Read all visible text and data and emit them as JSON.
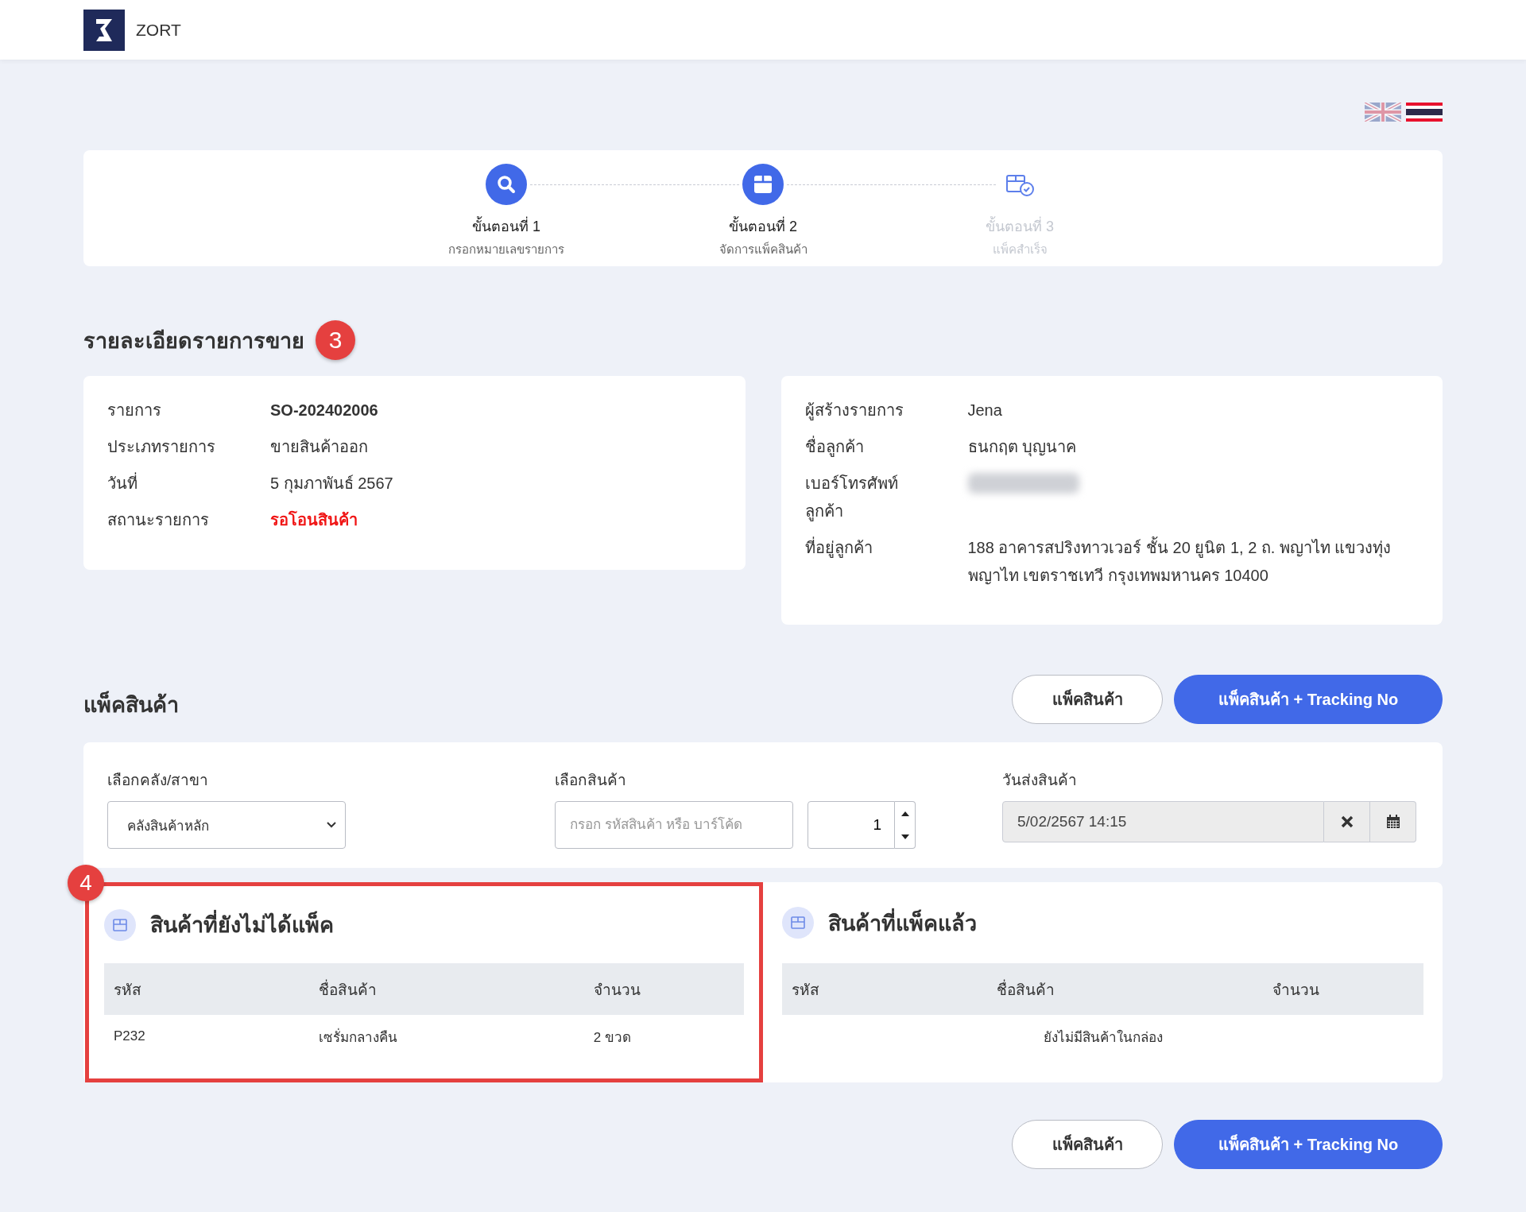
{
  "header": {
    "brand": "ZORT"
  },
  "languages": [
    {
      "kind": "en",
      "selected": false
    },
    {
      "kind": "th",
      "selected": true
    }
  ],
  "steps": [
    {
      "title": "ขั้นตอนที่ 1",
      "subtitle": "กรอกหมายเลขรายการ",
      "active": true
    },
    {
      "title": "ขั้นตอนที่ 2",
      "subtitle": "จัดการแพ็คสินค้า",
      "active": true
    },
    {
      "title": "ขั้นตอนที่ 3",
      "subtitle": "แพ็คสำเร็จ",
      "active": false
    }
  ],
  "order_details": {
    "title": "รายละเอียดรายการขาย",
    "marker": "3",
    "left": [
      {
        "label": "รายการ",
        "value": "SO-202402006",
        "kind": "bold"
      },
      {
        "label": "ประเภทรายการ",
        "value": "ขายสินค้าออก",
        "kind": "plain"
      },
      {
        "label": "วันที่",
        "value": "5 กุมภาพันธ์ 2567",
        "kind": "plain"
      },
      {
        "label": "สถานะรายการ",
        "value": "รอโอนสินค้า",
        "kind": "status"
      }
    ],
    "right": [
      {
        "label": "ผู้สร้างรายการ",
        "value": "Jena",
        "kind": "plain"
      },
      {
        "label": "ชื่อลูกค้า",
        "value": "ธนกฤต บุญนาค",
        "kind": "plain"
      },
      {
        "label": "เบอร์โทรศัพท์ลูกค้า",
        "kind": "blurred"
      },
      {
        "label": "ที่อยู่ลูกค้า",
        "value": "188 อาคารสปริงทาวเวอร์ ชั้น 20 ยูนิต 1, 2 ถ. พญาไท แขวงทุ่ง พญาไท เขตราชเทวี กรุงเทพมหานคร 10400",
        "kind": "plain"
      }
    ]
  },
  "pack": {
    "title": "แพ็คสินค้า",
    "buttons": [
      {
        "label": "แพ็คสินค้า",
        "kind": "outline"
      },
      {
        "label": "แพ็คสินค้า + Tracking No",
        "kind": "primary"
      }
    ],
    "warehouse": {
      "label": "เลือกคลัง/สาขา",
      "value": "คลังสินค้าหลัก"
    },
    "product": {
      "label": "เลือกสินค้า",
      "placeholder": "กรอก รหัสสินค้า หรือ บาร์โค้ด"
    },
    "quantity": "1",
    "ship_date": {
      "label": "วันส่งสินค้า",
      "value": "5/02/2567 14:15"
    }
  },
  "tables": [
    {
      "title": "สินค้าที่ยังไม่ได้แพ็ค",
      "highlighted": true,
      "marker": "4",
      "columns": [
        "รหัส",
        "ชื่อสินค้า",
        "จำนวน"
      ],
      "rows": [
        [
          "P232",
          "เซรั่มกลางคืน",
          "2 ขวด"
        ]
      ]
    },
    {
      "title": "สินค้าที่แพ็คแล้ว",
      "highlighted": false,
      "columns": [
        "รหัส",
        "ชื่อสินค้า",
        "จำนวน"
      ],
      "empty_text": "ยังไม่มีสินค้าในกล่อง"
    }
  ],
  "bottom_buttons": [
    {
      "label": "แพ็คสินค้า",
      "kind": "outline"
    },
    {
      "label": "แพ็คสินค้า + Tracking No",
      "kind": "primary"
    }
  ]
}
